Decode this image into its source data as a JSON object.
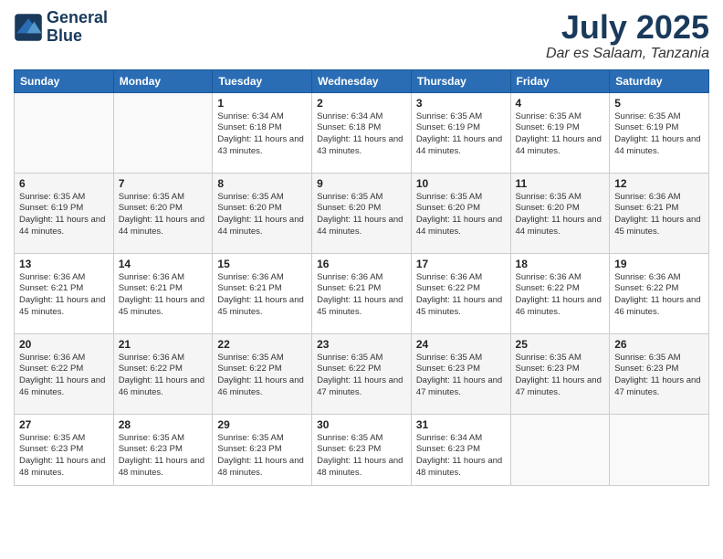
{
  "logo": {
    "line1": "General",
    "line2": "Blue"
  },
  "title": "July 2025",
  "subtitle": "Dar es Salaam, Tanzania",
  "weekdays": [
    "Sunday",
    "Monday",
    "Tuesday",
    "Wednesday",
    "Thursday",
    "Friday",
    "Saturday"
  ],
  "weeks": [
    [
      {
        "day": "",
        "info": ""
      },
      {
        "day": "",
        "info": ""
      },
      {
        "day": "1",
        "info": "Sunrise: 6:34 AM\nSunset: 6:18 PM\nDaylight: 11 hours and 43 minutes."
      },
      {
        "day": "2",
        "info": "Sunrise: 6:34 AM\nSunset: 6:18 PM\nDaylight: 11 hours and 43 minutes."
      },
      {
        "day": "3",
        "info": "Sunrise: 6:35 AM\nSunset: 6:19 PM\nDaylight: 11 hours and 44 minutes."
      },
      {
        "day": "4",
        "info": "Sunrise: 6:35 AM\nSunset: 6:19 PM\nDaylight: 11 hours and 44 minutes."
      },
      {
        "day": "5",
        "info": "Sunrise: 6:35 AM\nSunset: 6:19 PM\nDaylight: 11 hours and 44 minutes."
      }
    ],
    [
      {
        "day": "6",
        "info": "Sunrise: 6:35 AM\nSunset: 6:19 PM\nDaylight: 11 hours and 44 minutes."
      },
      {
        "day": "7",
        "info": "Sunrise: 6:35 AM\nSunset: 6:20 PM\nDaylight: 11 hours and 44 minutes."
      },
      {
        "day": "8",
        "info": "Sunrise: 6:35 AM\nSunset: 6:20 PM\nDaylight: 11 hours and 44 minutes."
      },
      {
        "day": "9",
        "info": "Sunrise: 6:35 AM\nSunset: 6:20 PM\nDaylight: 11 hours and 44 minutes."
      },
      {
        "day": "10",
        "info": "Sunrise: 6:35 AM\nSunset: 6:20 PM\nDaylight: 11 hours and 44 minutes."
      },
      {
        "day": "11",
        "info": "Sunrise: 6:35 AM\nSunset: 6:20 PM\nDaylight: 11 hours and 44 minutes."
      },
      {
        "day": "12",
        "info": "Sunrise: 6:36 AM\nSunset: 6:21 PM\nDaylight: 11 hours and 45 minutes."
      }
    ],
    [
      {
        "day": "13",
        "info": "Sunrise: 6:36 AM\nSunset: 6:21 PM\nDaylight: 11 hours and 45 minutes."
      },
      {
        "day": "14",
        "info": "Sunrise: 6:36 AM\nSunset: 6:21 PM\nDaylight: 11 hours and 45 minutes."
      },
      {
        "day": "15",
        "info": "Sunrise: 6:36 AM\nSunset: 6:21 PM\nDaylight: 11 hours and 45 minutes."
      },
      {
        "day": "16",
        "info": "Sunrise: 6:36 AM\nSunset: 6:21 PM\nDaylight: 11 hours and 45 minutes."
      },
      {
        "day": "17",
        "info": "Sunrise: 6:36 AM\nSunset: 6:22 PM\nDaylight: 11 hours and 45 minutes."
      },
      {
        "day": "18",
        "info": "Sunrise: 6:36 AM\nSunset: 6:22 PM\nDaylight: 11 hours and 46 minutes."
      },
      {
        "day": "19",
        "info": "Sunrise: 6:36 AM\nSunset: 6:22 PM\nDaylight: 11 hours and 46 minutes."
      }
    ],
    [
      {
        "day": "20",
        "info": "Sunrise: 6:36 AM\nSunset: 6:22 PM\nDaylight: 11 hours and 46 minutes."
      },
      {
        "day": "21",
        "info": "Sunrise: 6:36 AM\nSunset: 6:22 PM\nDaylight: 11 hours and 46 minutes."
      },
      {
        "day": "22",
        "info": "Sunrise: 6:35 AM\nSunset: 6:22 PM\nDaylight: 11 hours and 46 minutes."
      },
      {
        "day": "23",
        "info": "Sunrise: 6:35 AM\nSunset: 6:22 PM\nDaylight: 11 hours and 47 minutes."
      },
      {
        "day": "24",
        "info": "Sunrise: 6:35 AM\nSunset: 6:23 PM\nDaylight: 11 hours and 47 minutes."
      },
      {
        "day": "25",
        "info": "Sunrise: 6:35 AM\nSunset: 6:23 PM\nDaylight: 11 hours and 47 minutes."
      },
      {
        "day": "26",
        "info": "Sunrise: 6:35 AM\nSunset: 6:23 PM\nDaylight: 11 hours and 47 minutes."
      }
    ],
    [
      {
        "day": "27",
        "info": "Sunrise: 6:35 AM\nSunset: 6:23 PM\nDaylight: 11 hours and 48 minutes."
      },
      {
        "day": "28",
        "info": "Sunrise: 6:35 AM\nSunset: 6:23 PM\nDaylight: 11 hours and 48 minutes."
      },
      {
        "day": "29",
        "info": "Sunrise: 6:35 AM\nSunset: 6:23 PM\nDaylight: 11 hours and 48 minutes."
      },
      {
        "day": "30",
        "info": "Sunrise: 6:35 AM\nSunset: 6:23 PM\nDaylight: 11 hours and 48 minutes."
      },
      {
        "day": "31",
        "info": "Sunrise: 6:34 AM\nSunset: 6:23 PM\nDaylight: 11 hours and 48 minutes."
      },
      {
        "day": "",
        "info": ""
      },
      {
        "day": "",
        "info": ""
      }
    ]
  ]
}
